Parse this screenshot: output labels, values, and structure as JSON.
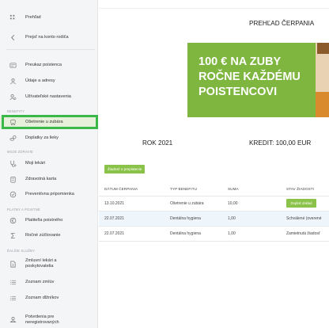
{
  "sidebar": {
    "overview": "Prehľad",
    "parent_account": "Prejsť na konto rodiča",
    "insurance_card": "Preukaz poistenca",
    "personal_data": "Údaje a adresy",
    "user_settings": "Užívateľské nastavenia",
    "section_benefits": "BENEFITY",
    "dental_care": "Ošetrenie u zubára",
    "drug_copay": "Doplatky za lieky",
    "section_health": "MOJE ZDRAVIE",
    "my_doctors": "Moji lekári",
    "health_card": "Zdravotná karta",
    "prevention_reminder": "Preventívna pripomienka",
    "section_payments": "PLATBY A POISTNÉ",
    "premium_payer": "Platiteľia poistného",
    "annual_settlement": "Ročné zúčtovanie",
    "section_services": "ĎALŠIE SLUŽBY",
    "contract_doctors": "Zmluvní lekári a",
    "contract_doctors_2": "poskytovatelia",
    "contract_list": "Zoznam zmlúv",
    "debtors_list": "Zoznam dlžníkov",
    "certificates": "Potvrdenia pre",
    "certificates_2": "neregistrovaných"
  },
  "main": {
    "page_title": "PREHĽAD ČERPANIA",
    "banner_line1": "100 € NA ZUBY",
    "banner_line2": "ROČNE KAŽDÉMU",
    "banner_line3": "POISTENCOVI",
    "year": "ROK 2021",
    "credit": "KREDIT: 100,00 EUR",
    "request_button": "Žiadosť o preplatenie"
  },
  "table": {
    "headers": [
      "DÁTUM ČERPANIA",
      "TYP BENEFITU",
      "SUMA",
      "STAV ŽIADOSTI"
    ],
    "rows": [
      {
        "date": "13.10.2021",
        "type": "Ošetrenie u zubára",
        "amount": "10,00",
        "status": "Doplniť doklad"
      },
      {
        "date": "22.07.2021",
        "type": "Dentálna hygiena",
        "amount": "1,00",
        "status": "Schválené (overené"
      },
      {
        "date": "22.07.2021",
        "type": "Dentálna hygiena",
        "amount": "1,00",
        "status": "Zamietnutá žiadosť"
      }
    ]
  },
  "colors": {
    "accent_green": "#8bc34a",
    "highlight_green": "#3ab84a",
    "banner_green": "#7eb640"
  }
}
